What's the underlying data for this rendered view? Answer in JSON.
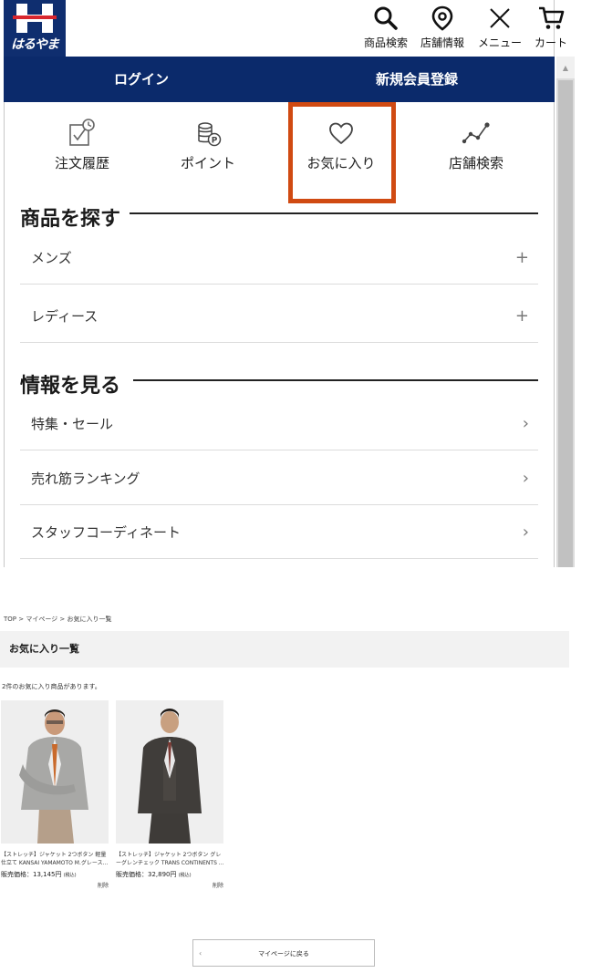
{
  "header": {
    "logo_text": "はるやま",
    "icons": [
      {
        "name": "search-icon",
        "label": "商品検索"
      },
      {
        "name": "map-pin-icon",
        "label": "店舗情報"
      },
      {
        "name": "close-icon",
        "label": "メニュー"
      },
      {
        "name": "cart-icon",
        "label": "カート"
      }
    ]
  },
  "nav": {
    "login_label": "ログイン",
    "register_label": "新規会員登録"
  },
  "quick_links": [
    {
      "icon": "order-history-icon",
      "label": "注文履歴"
    },
    {
      "icon": "points-icon",
      "label": "ポイント"
    },
    {
      "icon": "heart-icon",
      "label": "お気に入り"
    },
    {
      "icon": "store-search-icon",
      "label": "店舗検索"
    }
  ],
  "products_section": {
    "title": "商品を探す",
    "items": [
      {
        "label": "メンズ",
        "control": "+"
      },
      {
        "label": "レディース",
        "control": "+"
      }
    ]
  },
  "info_section": {
    "title": "情報を見る",
    "items": [
      {
        "label": "特集・セール",
        "control": "›"
      },
      {
        "label": "売れ筋ランキング",
        "control": "›"
      },
      {
        "label": "スタッフコーディネート",
        "control": "›"
      }
    ]
  },
  "colors": {
    "navy": "#0b2a6b",
    "highlight": "#d04a12"
  },
  "favorites_page": {
    "breadcrumb": "TOP > マイページ > お気に入り一覧",
    "title": "お気に入り一覧",
    "count_text": "2件のお気に入り商品があります。",
    "items": [
      {
        "title_line1": "【ストレッチ】ジャケット 2つボタン 軽量",
        "title_line2": "仕立て KANSAI YAMAMOTO M.グレース...",
        "price_label": "販売価格：",
        "price": "13,145円",
        "tax": "(税込)",
        "delete_label": "削除"
      },
      {
        "title_line1": "【ストレッチ】ジャケット 2つボタン グレ",
        "title_line2": "ーグレンチェック TRANS CONTINENTS ...",
        "price_label": "販売価格：",
        "price": "32,890円",
        "tax": "(税込)",
        "delete_label": "削除"
      }
    ],
    "back_button_chevron": "‹",
    "back_button_label": "マイページに戻る"
  }
}
